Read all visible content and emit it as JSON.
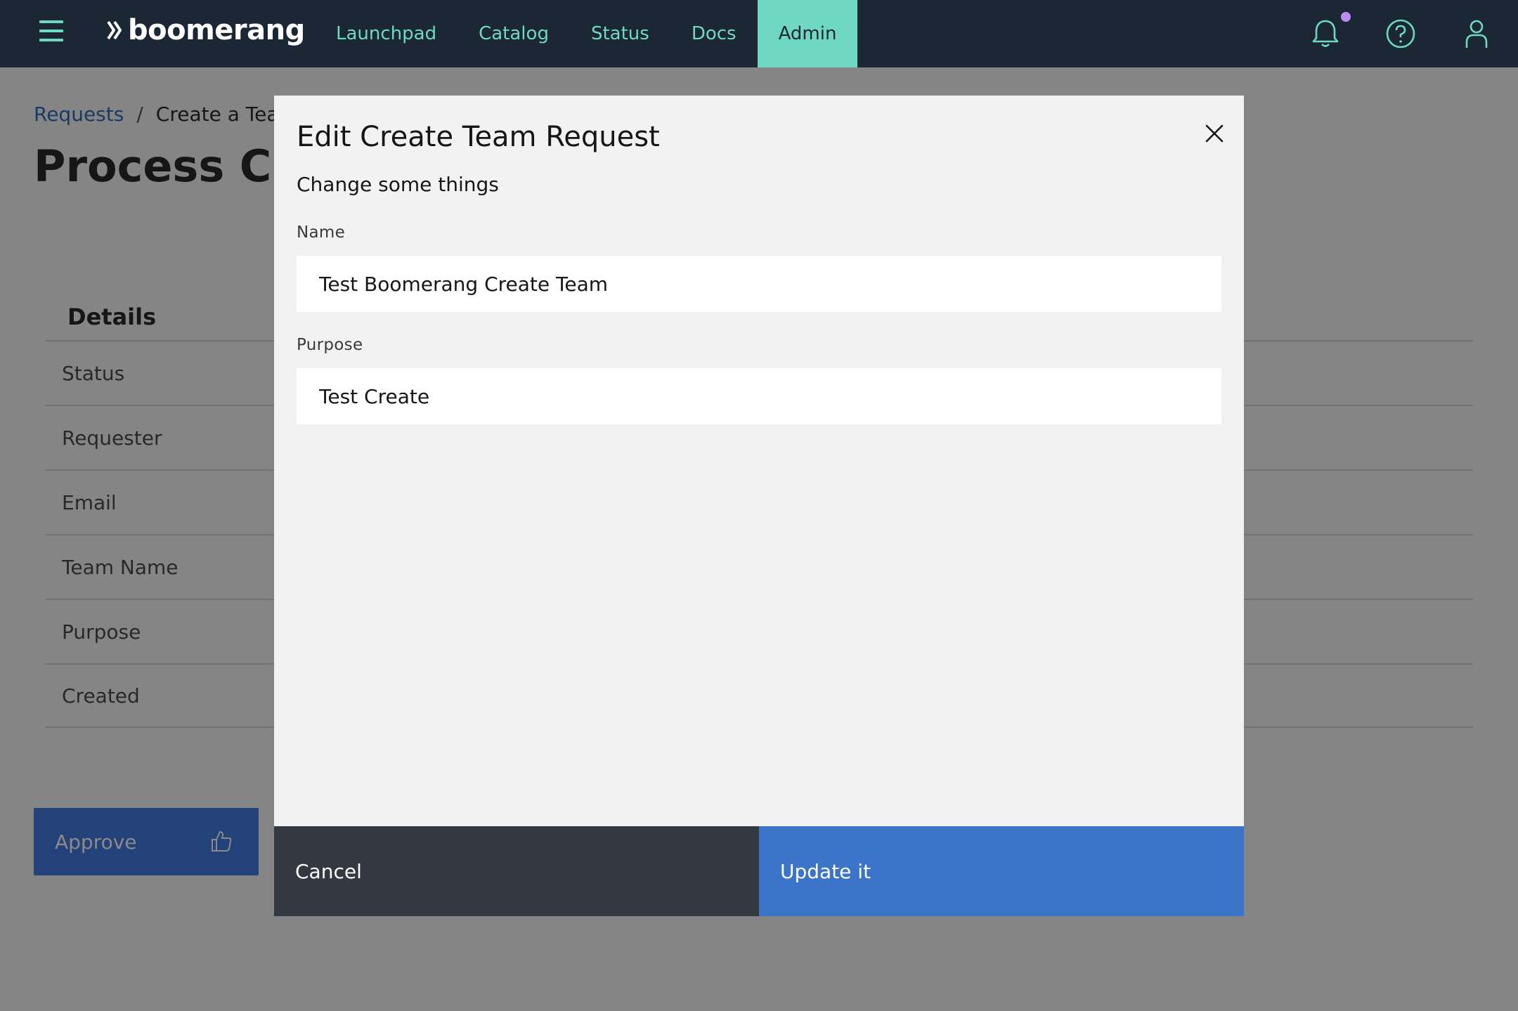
{
  "header": {
    "brand": "boomerang",
    "menu_icon": "hamburger-menu-icon",
    "nav": [
      {
        "label": "Launchpad",
        "active": false
      },
      {
        "label": "Catalog",
        "active": false
      },
      {
        "label": "Status",
        "active": false
      },
      {
        "label": "Docs",
        "active": false
      },
      {
        "label": "Admin",
        "active": true
      }
    ],
    "icons": [
      "bell-icon",
      "help-icon",
      "user-icon"
    ],
    "colors": {
      "bar": "#1b2734",
      "accent": "#6fd8c2",
      "notification_dot": "#b98cf2"
    }
  },
  "page": {
    "breadcrumb": {
      "link": "Requests",
      "separator": "/",
      "current": "Create a Team"
    },
    "title": "Process Create Team Request",
    "details": {
      "heading": "Details",
      "rows": [
        "Status",
        "Requester",
        "Email",
        "Team Name",
        "Purpose",
        "Created"
      ]
    },
    "approve_label": "Approve"
  },
  "modal": {
    "title": "Edit Create Team Request",
    "subtitle": "Change some things",
    "fields": {
      "name": {
        "label": "Name",
        "value": "Test Boomerang Create Team"
      },
      "purpose": {
        "label": "Purpose",
        "value": "Test Create"
      }
    },
    "cancel_label": "Cancel",
    "submit_label": "Update it",
    "colors": {
      "cancel": "#343841",
      "submit": "#3b74c8"
    }
  }
}
